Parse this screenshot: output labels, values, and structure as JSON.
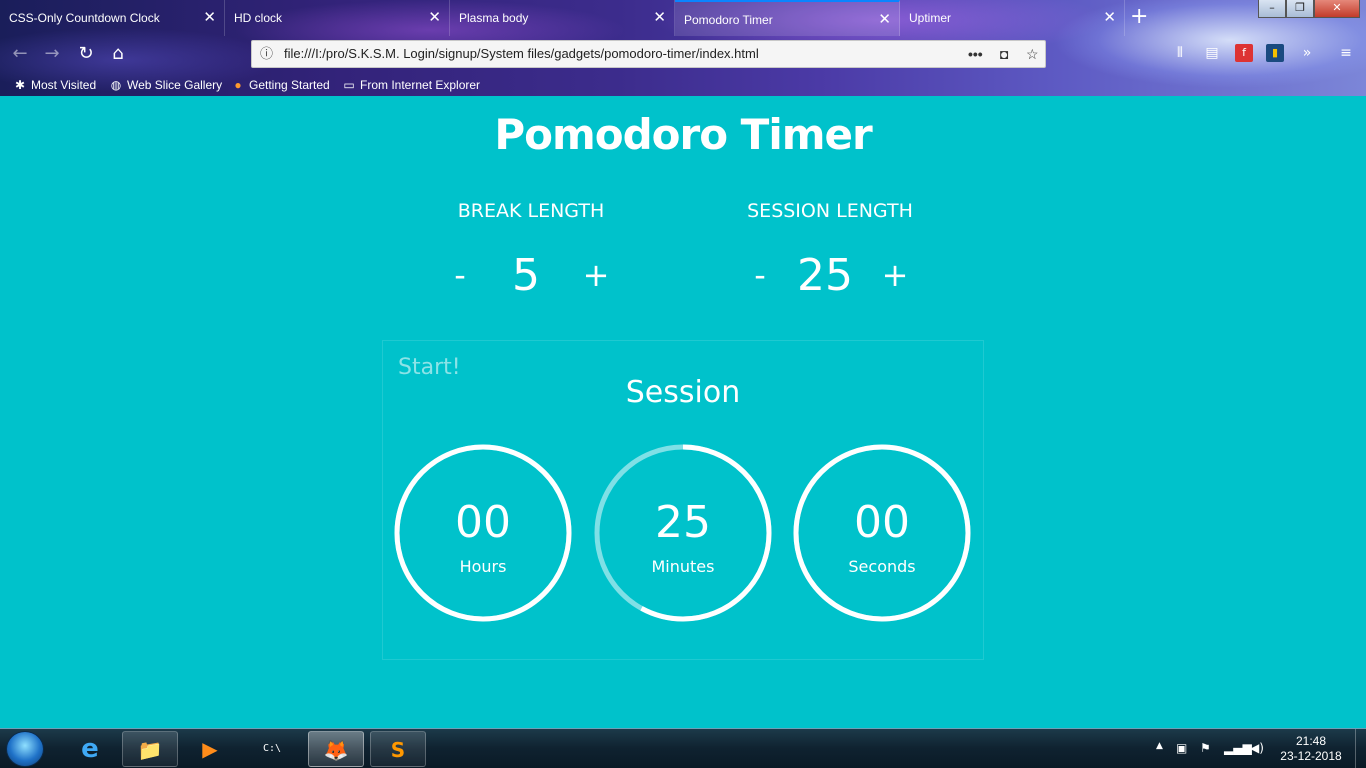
{
  "browser": {
    "tabs": [
      {
        "title": "CSS-Only Countdown Clock"
      },
      {
        "title": "HD clock"
      },
      {
        "title": "Plasma body"
      },
      {
        "title": "Pomodoro Timer"
      },
      {
        "title": "Uptimer"
      }
    ],
    "active_tab_index": 3,
    "url": "file:///I:/pro/S.K.S.M. Login/signup/System files/gadgets/pomodoro-timer/index.html",
    "bookmarks": [
      {
        "label": "Most Visited",
        "icon": "gear-icon"
      },
      {
        "label": "Web Slice Gallery",
        "icon": "globe-icon"
      },
      {
        "label": "Getting Started",
        "icon": "firefox-icon"
      },
      {
        "label": "From Internet Explorer",
        "icon": "folder-icon"
      }
    ],
    "accent_color": "#0a84ff"
  },
  "app": {
    "title": "Pomodoro Timer",
    "break": {
      "label": "BREAK LENGTH",
      "minus": "-",
      "value": "5",
      "plus": "+"
    },
    "session": {
      "label": "SESSION LENGTH",
      "minus": "-",
      "value": "25",
      "plus": "+"
    },
    "start_label": "Start!",
    "mode": "Session",
    "dials": [
      {
        "value": "00",
        "unit": "Hours",
        "progress": 1.0
      },
      {
        "value": "25",
        "unit": "Minutes",
        "progress": 0.58
      },
      {
        "value": "00",
        "unit": "Seconds",
        "progress": 1.0
      }
    ],
    "background_color": "#00c2cb",
    "ring_color": "#ffffff",
    "ring_track_color": "#7fe0e6"
  },
  "taskbar": {
    "items": [
      {
        "name": "internet-explorer-icon",
        "glyph": "e",
        "state": "none"
      },
      {
        "name": "file-explorer-icon",
        "glyph": "📁",
        "state": "open"
      },
      {
        "name": "media-player-icon",
        "glyph": "▶",
        "state": "none"
      },
      {
        "name": "command-prompt-icon",
        "glyph": "C:\\",
        "state": "none"
      },
      {
        "name": "firefox-icon",
        "glyph": "🦊",
        "state": "active"
      },
      {
        "name": "sublime-text-icon",
        "glyph": "S",
        "state": "open"
      }
    ],
    "clock_time": "21:48",
    "clock_date": "23-12-2018"
  }
}
